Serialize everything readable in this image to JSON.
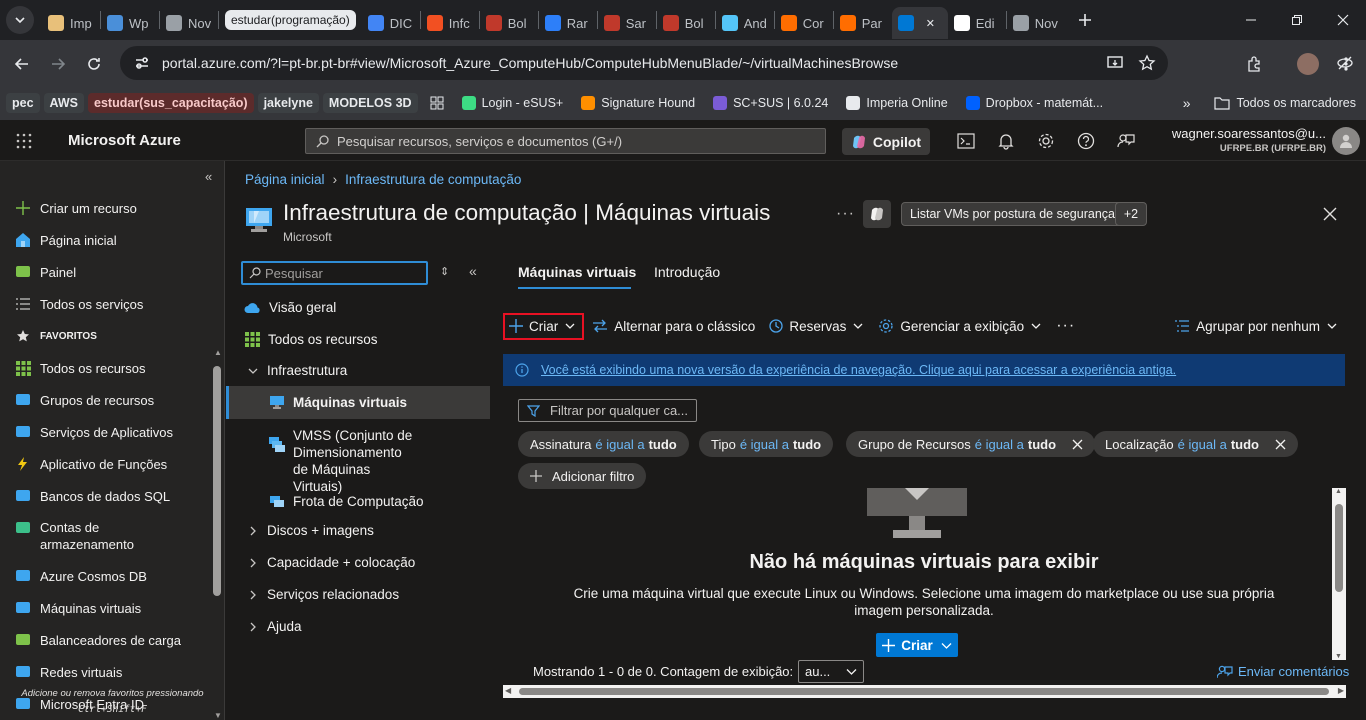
{
  "browser": {
    "tabs": [
      {
        "label": "Imp",
        "color": "#e8c07a"
      },
      {
        "label": "Wp",
        "color": "#4a8fd9"
      },
      {
        "label": "Nov",
        "color": "#9aa0a6"
      },
      {
        "label": "DIC",
        "color": "#4285f4"
      },
      {
        "label": "Infc",
        "color": "#f25022"
      },
      {
        "label": "Bol",
        "color": "#c0392b"
      },
      {
        "label": "Rar",
        "color": "#2d7ff9"
      },
      {
        "label": "Sar",
        "color": "#c0392b"
      },
      {
        "label": "Bol",
        "color": "#c0392b"
      },
      {
        "label": "And",
        "color": "#54c5f8"
      },
      {
        "label": "Cor",
        "color": "#ff6d00"
      },
      {
        "label": "Par",
        "color": "#ff6d00"
      },
      {
        "label": "",
        "color": "#0078d4"
      },
      {
        "label": "Edi",
        "color": "#ffffff"
      },
      {
        "label": "Nov",
        "color": "#9aa0a6"
      }
    ],
    "tab_group_label": "estudar(programação)",
    "url": "portal.azure.com/?l=pt-br.pt-br#view/Microsoft_Azure_ComputeHub/ComputeHubMenuBlade/~/virtualMachinesBrowse",
    "bookmarks": {
      "chips": [
        {
          "label": "pec",
          "bg": "#3c4043",
          "fg": "#e8eaed"
        },
        {
          "label": "AWS",
          "bg": "#3c4043",
          "fg": "#e8eaed"
        },
        {
          "label": "estudar(sus_capacitação)",
          "bg": "#5c2b2b",
          "fg": "#f8c9c9"
        },
        {
          "label": "jakelyne",
          "bg": "#3c4043",
          "fg": "#e8eaed"
        },
        {
          "label": "MODELOS 3D",
          "bg": "#3c4043",
          "fg": "#e8eaed"
        }
      ],
      "links": [
        {
          "label": "Login - eSUS+",
          "color": "#3ddc84"
        },
        {
          "label": "Signature Hound",
          "color": "#ff8f00"
        },
        {
          "label": "SC+SUS | 6.0.24",
          "color": "#7b5cd6"
        },
        {
          "label": "Imperia Online",
          "color": "#e8eaed"
        },
        {
          "label": "Dropbox - matemát...",
          "color": "#0061ff"
        }
      ],
      "all_bookmarks": "Todos os marcadores"
    }
  },
  "azure": {
    "brand": "Microsoft Azure",
    "search_placeholder": "Pesquisar recursos, serviços e documentos (G+/)",
    "copilot": "Copilot",
    "user_name": "wagner.soaressantos@u...",
    "user_org": "UFRPE.BR (UFRPE.BR)"
  },
  "leftnav": {
    "items": [
      {
        "label": "Criar um recurso",
        "icon": "plus-icon"
      },
      {
        "label": "Página inicial",
        "icon": "home-icon"
      },
      {
        "label": "Painel",
        "icon": "dashboard-icon"
      },
      {
        "label": "Todos os serviços",
        "icon": "list-icon"
      },
      {
        "label": "FAVORITOS",
        "icon": "star-icon"
      },
      {
        "label": "Todos os recursos",
        "icon": "grid-icon"
      },
      {
        "label": "Grupos de recursos",
        "icon": "resource-group-icon"
      },
      {
        "label": "Serviços de Aplicativos",
        "icon": "app-service-icon"
      },
      {
        "label": "Aplicativo de Funções",
        "icon": "function-icon"
      },
      {
        "label": "Bancos de dados SQL",
        "icon": "sql-icon"
      },
      {
        "label": "Contas de armazenamento",
        "icon": "storage-icon"
      },
      {
        "label": "Azure Cosmos DB",
        "icon": "cosmos-icon"
      },
      {
        "label": "Máquinas virtuais",
        "icon": "vm-icon"
      },
      {
        "label": "Balanceadores de carga",
        "icon": "load-balancer-icon"
      },
      {
        "label": "Redes virtuais",
        "icon": "vnet-icon"
      },
      {
        "label": "Microsoft Entra ID",
        "icon": "entra-icon"
      }
    ],
    "footer_line1": "Adicione ou remova favoritos pressionando",
    "footer_line2": "Ctrl+Shift+F"
  },
  "breadcrumb": {
    "home": "Página inicial",
    "current": "Infraestrutura de computação"
  },
  "page": {
    "title": "Infraestrutura de computação | Máquinas virtuais",
    "subtitle": "Microsoft",
    "security_button": "Listar VMs por postura de segurança",
    "more_count": "+2"
  },
  "menu": {
    "search_placeholder": "Pesquisar",
    "items": {
      "overview": "Visão geral",
      "all_resources": "Todos os recursos",
      "infra": "Infraestrutura",
      "vms": "Máquinas virtuais",
      "vmss": "VMSS (Conjunto de Dimensionamento de Máquinas Virtuais)",
      "fleet": "Frota de Computação",
      "disks": "Discos + imagens",
      "capacity": "Capacidade + colocação",
      "related": "Serviços relacionados",
      "help": "Ajuda"
    }
  },
  "tabs": {
    "vms": "Máquinas virtuais",
    "intro": "Introdução"
  },
  "commands": {
    "create": "Criar",
    "switch_classic": "Alternar para o clássico",
    "reservations": "Reservas",
    "manage_view": "Gerenciar a exibição",
    "group_by": "Agrupar por nenhum"
  },
  "banner": "Você está exibindo uma nova versão da experiência de navegação. Clique aqui para acessar a experiência antiga.",
  "filter": {
    "placeholder": "Filtrar por qualquer ca...",
    "pills": {
      "sub_key": "Assinatura",
      "sub_op": "é igual a",
      "sub_val": "tudo",
      "type_key": "Tipo",
      "type_op": "é igual a",
      "type_val": "tudo",
      "rg_key": "Grupo de Recursos",
      "rg_op": "é igual a",
      "rg_val": "tudo",
      "loc_key": "Localização",
      "loc_op": "é igual a",
      "loc_val": "tudo"
    },
    "add": "Adicionar filtro"
  },
  "empty": {
    "title": "Não há máquinas virtuais para exibir",
    "desc": "Crie uma máquina virtual que execute Linux ou Windows. Selecione uma imagem do marketplace ou use sua própria imagem personalizada.",
    "create": "Criar"
  },
  "footer": {
    "showing": "Mostrando 1 - 0 de 0. Contagem de exibição:",
    "count": "au...",
    "feedback": "Enviar comentários"
  }
}
